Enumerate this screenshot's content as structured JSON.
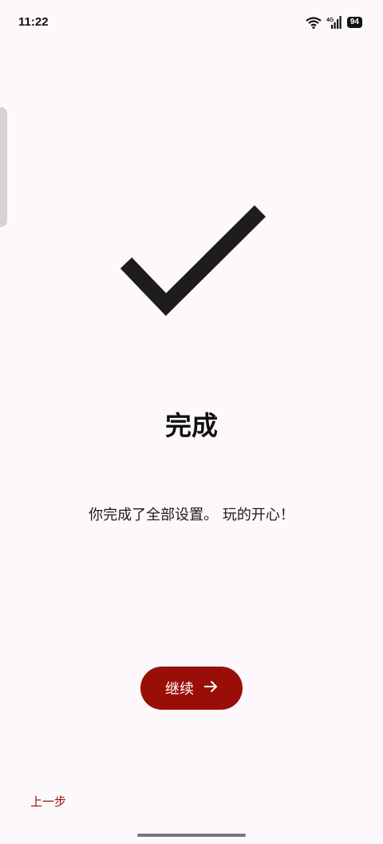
{
  "status_bar": {
    "time": "11:22",
    "network": "4G",
    "battery": "94",
    "icons": [
      "wifi-icon",
      "signal-icon",
      "battery-icon"
    ]
  },
  "main": {
    "icon": "checkmark-icon",
    "title": "完成",
    "message": "你完成了全部设置。 玩的开心！"
  },
  "actions": {
    "continue_label": "继续",
    "continue_icon": "arrow-right-icon",
    "back_label": "上一步"
  },
  "colors": {
    "accent": "#990f08",
    "background": "#fdf8fb",
    "text": "#1c1b1c"
  }
}
